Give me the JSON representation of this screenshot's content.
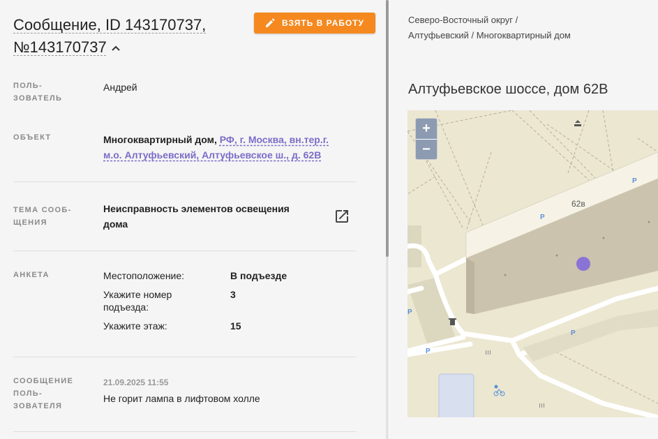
{
  "message": {
    "title": "Сообщение, ID 143170737, №143170737",
    "take_button": "ВЗЯТЬ В РАБОТУ"
  },
  "fields": {
    "user_label": "ПОЛЬ-\nЗОВАТЕЛЬ",
    "user_value": "Андрей",
    "object_label": "ОБЪЕКТ",
    "object_type": "Многоквартирный дом,",
    "object_address": "РФ, г. Москва, вн.тер.г. м.о. Алтуфьевский, Алтуфьевское ш., д. 62В",
    "topic_label": "ТЕМА СООБ-\nЩЕНИЯ",
    "topic_value": "Неисправность элементов освещения дома",
    "survey_label": "АНКЕТА",
    "survey": [
      {
        "q": "Местоположение:",
        "a": "В подъезде"
      },
      {
        "q": "Укажите номер подъезда:",
        "a": "3"
      },
      {
        "q": "Укажите этаж:",
        "a": "15"
      }
    ],
    "user_message_label": "СООБЩЕНИЕ\nПОЛЬ-\nЗОВАТЕЛЯ",
    "user_message_time": "21.09.2025 11:55",
    "user_message_text": "Не горит лампа в лифтовом холле"
  },
  "location": {
    "breadcrumb": "Северо-Восточный округ / Алтуфьевский / Многоквартирный дом",
    "address": "Алтуфьевское шоссе, дом 62В"
  },
  "map": {
    "building_label": "62в",
    "parking_label": "P",
    "zoom_in": "+",
    "zoom_out": "−"
  },
  "colors": {
    "accent": "#f5891f",
    "link": "#7b6cc8",
    "marker": "#8a73d6"
  }
}
